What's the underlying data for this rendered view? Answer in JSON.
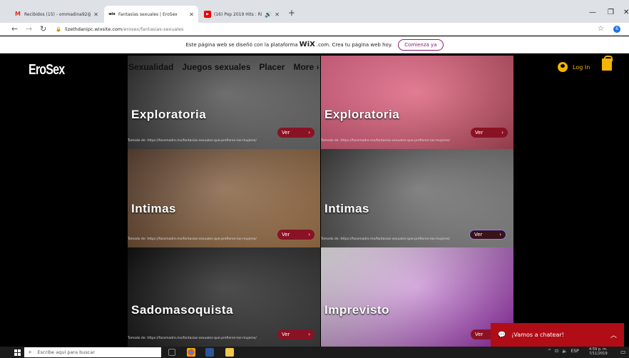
{
  "browser": {
    "tabs": [
      {
        "title": "Recibidos (15) - ommadina92@...",
        "icon": "gmail-icon",
        "active": false
      },
      {
        "title": "Fantasías sexuales | EroSex",
        "icon": "wix-icon",
        "active": true
      },
      {
        "title": "(16) Pop 2019 Hits : Rihanna",
        "icon": "youtube-icon",
        "active": false
      }
    ],
    "tab_favicons": [
      "M",
      "wix",
      "▶"
    ],
    "new_tab": "+",
    "url_host": "lizethdanipc.wixsite.com",
    "url_path": "/erosex/fantasias-sexuales",
    "profile_initial": "6"
  },
  "wix_banner": {
    "text_before": "Este página web se diseñó con la plataforma",
    "logo": "WiX",
    "logo_suffix": ".com",
    "text_after": ". Crea tu página web hoy.",
    "button": "Comienza ya"
  },
  "site": {
    "brand": "EroSex",
    "menu": [
      "Sexualidad",
      "Juegos sexuales",
      "Placer",
      "More"
    ],
    "login": "Log In"
  },
  "tiles": [
    {
      "title": "Exploratoria",
      "button": "Ver",
      "source": "Tomado de: https://facemadre.mx/fantasias-sexuales-que-prefieren-las-mujeres/",
      "colors": [
        "#2a2a2a",
        "#777777"
      ]
    },
    {
      "title": "Exploratoria",
      "button": "Ver",
      "source": "Tomado de: https://facemadre.mx/fantasias-sexuales-que-prefieren-las-mujeres/",
      "colors": [
        "#f26d93",
        "#c05060"
      ]
    },
    {
      "title": "Intimas",
      "button": "Ver",
      "source": "Tomado de: https://facemadre.mx/fantasias-sexuales-que-prefieren-las-mujeres/",
      "colors": [
        "#5a4030",
        "#b08050"
      ]
    },
    {
      "title": "Intimas",
      "button": "Ver",
      "source": "Tomado de: https://facemadre.mx/fantasias-sexuales-que-prefieren-las-mujeres/",
      "colors": [
        "#3a3a3a",
        "#9a9a9a"
      ]
    },
    {
      "title": "Sadomasoquista",
      "button": "Ver",
      "source": "Tomado de: https://facemadre.mx/fantasias-sexuales-que-prefieren-las-mujeres/",
      "colors": [
        "#0a0a0a",
        "#444444"
      ]
    },
    {
      "title": "Imprevisto",
      "button": "Ver",
      "source": "",
      "colors": [
        "#f4f4f4",
        "#9a2ab0"
      ]
    }
  ],
  "chat": {
    "label": "¡Vamos a chatear!"
  },
  "taskbar": {
    "search_placeholder": "Escribe aquí para buscar",
    "lang": "ESP",
    "time": "4:59 p. m.",
    "date": "7/11/2019"
  },
  "colors": {
    "accent_gold": "#f5b400",
    "ver_button": "#8a1225",
    "chat_red": "#b00d17",
    "wix_purple": "#8b1a7a"
  }
}
